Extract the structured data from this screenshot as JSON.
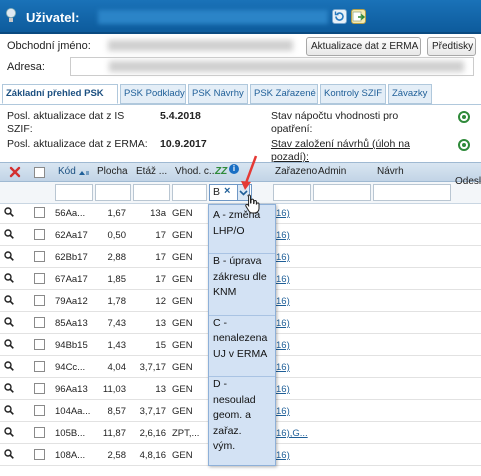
{
  "header": {
    "user_label": "Uživatel:"
  },
  "form": {
    "obchodni_label": "Obchodní jméno:",
    "adresa_label": "Adresa:",
    "update_button": "Aktualizace dat z ERMA",
    "print_button": "Předtisky"
  },
  "tabs": [
    {
      "label": "Základní přehled PSK"
    },
    {
      "label": "PSK Podklady"
    },
    {
      "label": "PSK Návrhy"
    },
    {
      "label": "PSK Zařazené"
    },
    {
      "label": "Kontroly SZIF"
    },
    {
      "label": "Závazky"
    }
  ],
  "info": {
    "szif_label": "Posl. aktualizace dat z IS SZIF:",
    "szif_date": "5.4.2018",
    "erma_label": "Posl. aktualizace dat z ERMA:",
    "erma_date": "10.9.2017",
    "napocet": "Stav nápočtu vhodnosti pro opatření:",
    "zalozeni": "Stav založení návrhů (úloh na pozadí):"
  },
  "grid": {
    "columns": {
      "kod": "Kód",
      "plocha": "Plocha",
      "etaz": "Etáž ...",
      "vhod": "Vhod. c...",
      "zz": "ZZ",
      "zarazeno": "Zařazeno",
      "admin": "Admin",
      "navrh": "Návrh",
      "odesl": "Odesl"
    },
    "zz_filter_value": "B",
    "rows": [
      {
        "kod": "56Aa...",
        "plocha": "1,67",
        "etaz": "13a",
        "vhod": "GEN",
        "link": "16)"
      },
      {
        "kod": "62Aa17",
        "plocha": "0,50",
        "etaz": "17",
        "vhod": "GEN",
        "link": "16)"
      },
      {
        "kod": "62Bb17",
        "plocha": "2,88",
        "etaz": "17",
        "vhod": "GEN",
        "link": "16)"
      },
      {
        "kod": "67Aa17",
        "plocha": "1,85",
        "etaz": "17",
        "vhod": "GEN",
        "link": "16)"
      },
      {
        "kod": "79Aa12",
        "plocha": "1,78",
        "etaz": "12",
        "vhod": "GEN",
        "link": "16)"
      },
      {
        "kod": "85Aa13",
        "plocha": "7,43",
        "etaz": "13",
        "vhod": "GEN",
        "link": "16)"
      },
      {
        "kod": "94Bb15",
        "plocha": "1,43",
        "etaz": "15",
        "vhod": "GEN",
        "link": "16)"
      },
      {
        "kod": "94Cc...",
        "plocha": "4,04",
        "etaz": "3,7,17",
        "vhod": "GEN",
        "link": "16)"
      },
      {
        "kod": "96Aa13",
        "plocha": "11,03",
        "etaz": "13",
        "vhod": "GEN",
        "link": "16)"
      },
      {
        "kod": "104Aa...",
        "plocha": "8,57",
        "etaz": "3,7,17",
        "vhod": "GEN",
        "link": "16)"
      },
      {
        "kod": "105B...",
        "plocha": "11,87",
        "etaz": "2,6,16",
        "vhod": "ZPT,...",
        "link": "16),G..."
      },
      {
        "kod": "108A...",
        "plocha": "2,58",
        "etaz": "4,8,16",
        "vhod": "GEN",
        "link": "16)"
      }
    ]
  },
  "dropdown": {
    "options": [
      {
        "lines": [
          "A - změna",
          "LHP/O"
        ]
      },
      {
        "lines": [
          "B - úprava",
          "zákresu dle",
          "KNM"
        ]
      },
      {
        "lines": [
          "C -",
          "nenalezena",
          "UJ v ERMA"
        ]
      },
      {
        "lines": [
          "D -",
          "nesoulad",
          "geom. a",
          "zařaz.",
          "vým."
        ]
      }
    ]
  },
  "colors": {
    "header_blue": "#1a72b8",
    "tab_text": "#1f5f98",
    "ok_green": "#2f8a3a",
    "dropdown_bg": "#d3e2f4",
    "arrow_red": "#e53935"
  }
}
